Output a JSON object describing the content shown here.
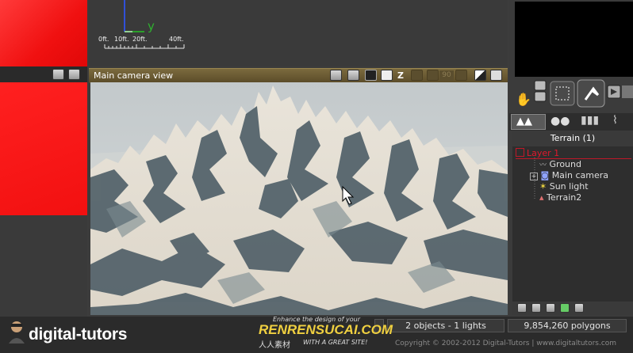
{
  "top_view": {
    "axis_y_label": "y",
    "scale_labels": [
      "0ft.",
      "10ft.",
      "20ft.",
      "40ft."
    ]
  },
  "camera": {
    "title": "Main camera view",
    "z_label": "Z",
    "zoom_value": "90"
  },
  "panel": {
    "section_title": "Terrain (1)",
    "tree": [
      {
        "label": "Layer 1",
        "color": "#e0182c"
      },
      {
        "label": "Ground",
        "color": "#e0e0e0"
      },
      {
        "label": "Main camera",
        "color": "#e0e0e0"
      },
      {
        "label": "Sun light",
        "color": "#e0e0e0"
      },
      {
        "label": "Terrain2",
        "color": "#e0e0e0"
      }
    ]
  },
  "status": {
    "objects": "2 objects - 1 lights",
    "polygons": "9,854,260 polygons"
  },
  "footer": {
    "logo_text": "digital-tutors",
    "copyright": "Copyright © 2002-2012 Digital-Tutors  |  www.digitaltutors.com"
  },
  "watermark": {
    "tagline": "Enhance the design of your",
    "brand": "RENRENSUCAI.COM",
    "chinese": "人人素材",
    "subtitle": "WITH A GREAT SITE!"
  },
  "colors": {
    "camera_header": "#6b5a32",
    "view_red": "#f21010",
    "layer_red": "#e0182c"
  }
}
